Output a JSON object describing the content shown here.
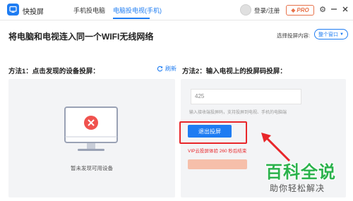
{
  "titlebar": {
    "app_name": "快投屏",
    "tabs": [
      {
        "label": "手机投电脑"
      },
      {
        "label": "电脑投电视(手机)",
        "active": true
      }
    ],
    "login_label": "登录/注册",
    "pro_label": "PRO",
    "icons": [
      "gear-icon",
      "minimize-icon",
      "close-icon"
    ]
  },
  "header": {
    "title": "将电脑和电视连入同一个WIFI无线网络",
    "content_label": "选择投屏内容:",
    "content_value": "整个窗口"
  },
  "method1": {
    "title": "方法1：点击发现的设备投屏：",
    "refresh_label": "刷新",
    "empty_text": "暂未发现可用设备"
  },
  "method2": {
    "title": "方法2：输入电视上的投屏码投屏：",
    "code_value": "425",
    "input_hint": "输入接收端投屏码，支持投屏到电视、手机的电脑端",
    "exit_button": "退出投屏",
    "vip_text": "VIP云投屏体验 260 秒后结束"
  },
  "watermark": {
    "main": "百科全说",
    "sub": "助你轻松解决"
  },
  "colors": {
    "accent": "#1e7cf2",
    "highlight": "#e8262a",
    "pro": "#e7724a",
    "watermark": "#2bb24c"
  }
}
